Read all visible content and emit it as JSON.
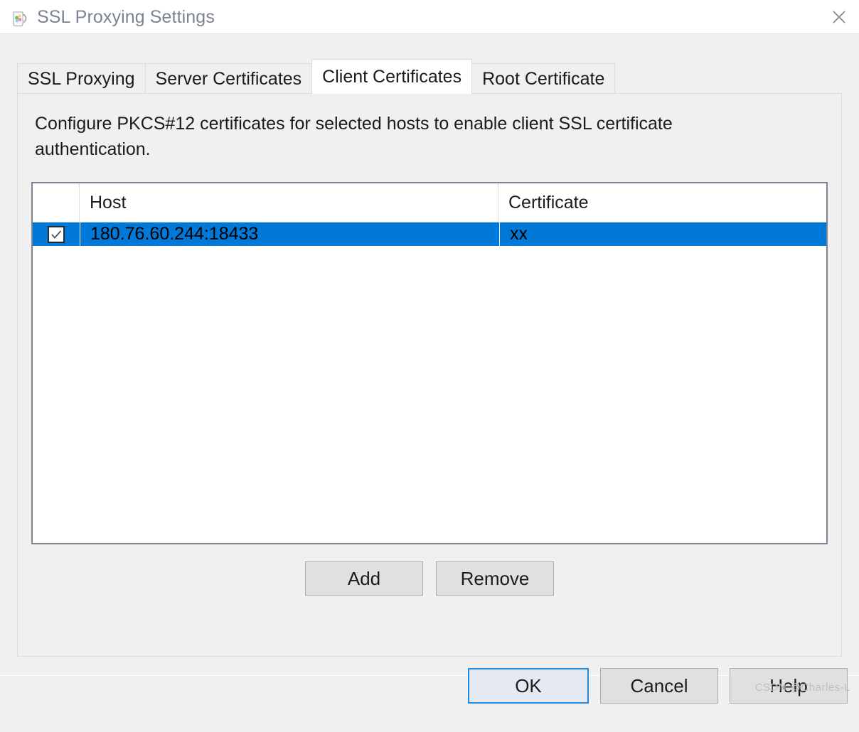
{
  "window": {
    "title": "SSL Proxying Settings",
    "app_icon": "charles-pitcher-icon",
    "close_icon": "close-icon"
  },
  "tabs": [
    {
      "label": "SSL Proxying",
      "selected": false
    },
    {
      "label": "Server Certificates",
      "selected": false
    },
    {
      "label": "Client Certificates",
      "selected": true
    },
    {
      "label": "Root Certificate",
      "selected": false
    }
  ],
  "panel": {
    "description": "Configure PKCS#12 certificates for selected hosts to enable client SSL certificate authentication."
  },
  "table": {
    "columns": [
      "",
      "Host",
      "Certificate"
    ],
    "rows": [
      {
        "checked": true,
        "host": "180.76.60.244:18433",
        "certificate": "xx",
        "selected": true
      }
    ]
  },
  "list_buttons": {
    "add": "Add",
    "remove": "Remove"
  },
  "dialog_buttons": {
    "ok": "OK",
    "cancel": "Cancel",
    "help": "Help"
  },
  "watermark": "CSDN @Charles-L",
  "colors": {
    "selection_blue": "#0078d7",
    "default_button_border": "#1f8ae0",
    "default_button_fill": "#e4e9f2",
    "dialog_background": "#f0f0f0",
    "title_text": "#7c8491",
    "table_border": "#7d8592"
  }
}
